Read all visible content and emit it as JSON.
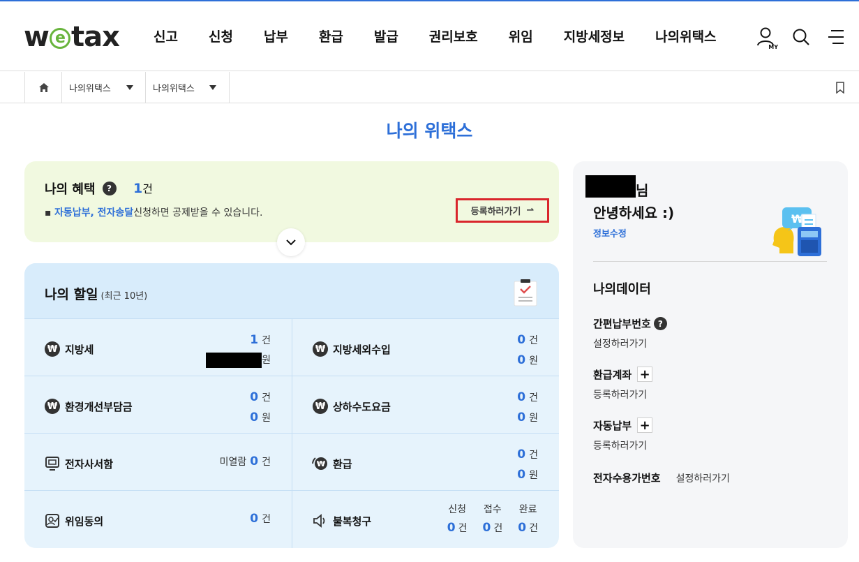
{
  "header": {
    "logo_w": "w",
    "logo_e": "e",
    "logo_rest": "tax",
    "nav": [
      "신고",
      "신청",
      "납부",
      "환급",
      "발급",
      "권리보호",
      "위임",
      "지방세정보",
      "나의위택스"
    ],
    "my_label": "MY",
    "icons": [
      "my-user-icon",
      "search-icon",
      "menu-icon"
    ]
  },
  "breadcrumb": {
    "level1": "나의위택스",
    "level2": "나의위택스"
  },
  "page_title": "나의 위택스",
  "benefit": {
    "title": "나의 혜택",
    "help": "?",
    "count": "1",
    "count_unit": "건",
    "bullet": "▪",
    "highlight": "자동납부, 전자송달",
    "desc_rest": "신청하면 공제받을 수 있습니다.",
    "register_label": "등록하러가기",
    "register_arrow": "⇀"
  },
  "todo": {
    "title": "나의 할일",
    "subtitle": "(최근 10년)",
    "items": [
      {
        "label": "지방세",
        "count": "1",
        "count_unit": "건",
        "amount_unit": "원"
      },
      {
        "label": "지방세외수입",
        "count": "0",
        "count_unit": "건",
        "amount": "0",
        "amount_unit": "원"
      },
      {
        "label": "환경개선부담금",
        "count": "0",
        "count_unit": "건",
        "amount": "0",
        "amount_unit": "원"
      },
      {
        "label": "상하수도요금",
        "count": "0",
        "count_unit": "건",
        "amount": "0",
        "amount_unit": "원"
      },
      {
        "label": "전자사서함",
        "prefix": "미열람",
        "count": "0",
        "count_unit": "건"
      },
      {
        "label": "환급",
        "count": "0",
        "count_unit": "건",
        "amount": "0",
        "amount_unit": "원"
      },
      {
        "label": "위임동의",
        "count": "0",
        "count_unit": "건"
      },
      {
        "label": "불복청구",
        "cols": [
          {
            "head": "신청",
            "value": "0",
            "unit": "건"
          },
          {
            "head": "접수",
            "value": "0",
            "unit": "건"
          },
          {
            "head": "완료",
            "value": "0",
            "unit": "건"
          }
        ]
      }
    ]
  },
  "side": {
    "name_suffix": "님",
    "greeting": "안녕하세요 :)",
    "edit_label": "정보수정",
    "mydata_title": "나의데이터",
    "simple_pay": {
      "title": "간편납부번호",
      "help": "?",
      "action": "설정하러가기"
    },
    "refund_account": {
      "title": "환급계좌",
      "plus": "+",
      "action": "등록하러가기"
    },
    "auto_pay": {
      "title": "자동납부",
      "plus": "+",
      "action": "등록하러가기"
    },
    "e_receive": {
      "title": "전자수용가번호",
      "action": "설정하러가기"
    }
  },
  "colors": {
    "accent": "#2d6fd8",
    "benefit_bg": "#f1f9e0",
    "todo_bg": "#e6f3fc",
    "highlight_border": "#d9262c"
  }
}
